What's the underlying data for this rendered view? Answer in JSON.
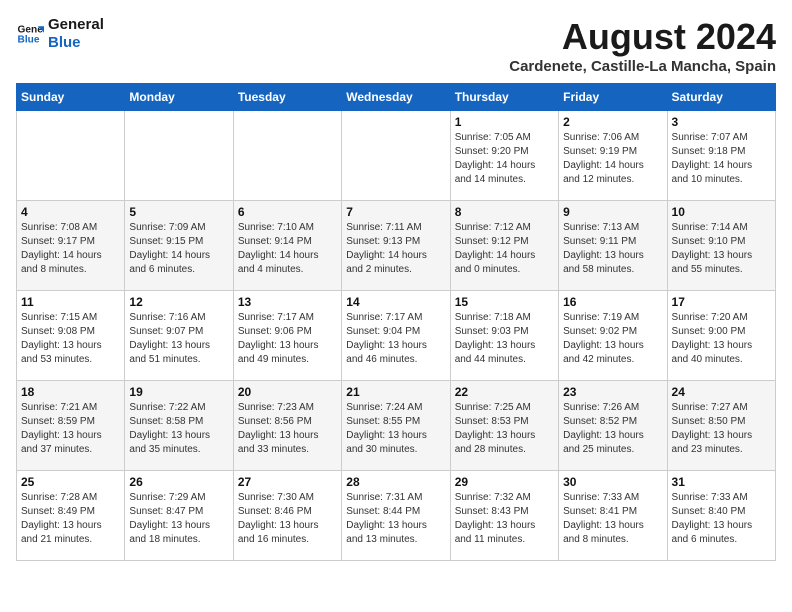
{
  "header": {
    "logo_line1": "General",
    "logo_line2": "Blue",
    "month_title": "August 2024",
    "location": "Cardenete, Castille-La Mancha, Spain"
  },
  "weekdays": [
    "Sunday",
    "Monday",
    "Tuesday",
    "Wednesday",
    "Thursday",
    "Friday",
    "Saturday"
  ],
  "weeks": [
    [
      {
        "day": "",
        "detail": ""
      },
      {
        "day": "",
        "detail": ""
      },
      {
        "day": "",
        "detail": ""
      },
      {
        "day": "",
        "detail": ""
      },
      {
        "day": "1",
        "detail": "Sunrise: 7:05 AM\nSunset: 9:20 PM\nDaylight: 14 hours\nand 14 minutes."
      },
      {
        "day": "2",
        "detail": "Sunrise: 7:06 AM\nSunset: 9:19 PM\nDaylight: 14 hours\nand 12 minutes."
      },
      {
        "day": "3",
        "detail": "Sunrise: 7:07 AM\nSunset: 9:18 PM\nDaylight: 14 hours\nand 10 minutes."
      }
    ],
    [
      {
        "day": "4",
        "detail": "Sunrise: 7:08 AM\nSunset: 9:17 PM\nDaylight: 14 hours\nand 8 minutes."
      },
      {
        "day": "5",
        "detail": "Sunrise: 7:09 AM\nSunset: 9:15 PM\nDaylight: 14 hours\nand 6 minutes."
      },
      {
        "day": "6",
        "detail": "Sunrise: 7:10 AM\nSunset: 9:14 PM\nDaylight: 14 hours\nand 4 minutes."
      },
      {
        "day": "7",
        "detail": "Sunrise: 7:11 AM\nSunset: 9:13 PM\nDaylight: 14 hours\nand 2 minutes."
      },
      {
        "day": "8",
        "detail": "Sunrise: 7:12 AM\nSunset: 9:12 PM\nDaylight: 14 hours\nand 0 minutes."
      },
      {
        "day": "9",
        "detail": "Sunrise: 7:13 AM\nSunset: 9:11 PM\nDaylight: 13 hours\nand 58 minutes."
      },
      {
        "day": "10",
        "detail": "Sunrise: 7:14 AM\nSunset: 9:10 PM\nDaylight: 13 hours\nand 55 minutes."
      }
    ],
    [
      {
        "day": "11",
        "detail": "Sunrise: 7:15 AM\nSunset: 9:08 PM\nDaylight: 13 hours\nand 53 minutes."
      },
      {
        "day": "12",
        "detail": "Sunrise: 7:16 AM\nSunset: 9:07 PM\nDaylight: 13 hours\nand 51 minutes."
      },
      {
        "day": "13",
        "detail": "Sunrise: 7:17 AM\nSunset: 9:06 PM\nDaylight: 13 hours\nand 49 minutes."
      },
      {
        "day": "14",
        "detail": "Sunrise: 7:17 AM\nSunset: 9:04 PM\nDaylight: 13 hours\nand 46 minutes."
      },
      {
        "day": "15",
        "detail": "Sunrise: 7:18 AM\nSunset: 9:03 PM\nDaylight: 13 hours\nand 44 minutes."
      },
      {
        "day": "16",
        "detail": "Sunrise: 7:19 AM\nSunset: 9:02 PM\nDaylight: 13 hours\nand 42 minutes."
      },
      {
        "day": "17",
        "detail": "Sunrise: 7:20 AM\nSunset: 9:00 PM\nDaylight: 13 hours\nand 40 minutes."
      }
    ],
    [
      {
        "day": "18",
        "detail": "Sunrise: 7:21 AM\nSunset: 8:59 PM\nDaylight: 13 hours\nand 37 minutes."
      },
      {
        "day": "19",
        "detail": "Sunrise: 7:22 AM\nSunset: 8:58 PM\nDaylight: 13 hours\nand 35 minutes."
      },
      {
        "day": "20",
        "detail": "Sunrise: 7:23 AM\nSunset: 8:56 PM\nDaylight: 13 hours\nand 33 minutes."
      },
      {
        "day": "21",
        "detail": "Sunrise: 7:24 AM\nSunset: 8:55 PM\nDaylight: 13 hours\nand 30 minutes."
      },
      {
        "day": "22",
        "detail": "Sunrise: 7:25 AM\nSunset: 8:53 PM\nDaylight: 13 hours\nand 28 minutes."
      },
      {
        "day": "23",
        "detail": "Sunrise: 7:26 AM\nSunset: 8:52 PM\nDaylight: 13 hours\nand 25 minutes."
      },
      {
        "day": "24",
        "detail": "Sunrise: 7:27 AM\nSunset: 8:50 PM\nDaylight: 13 hours\nand 23 minutes."
      }
    ],
    [
      {
        "day": "25",
        "detail": "Sunrise: 7:28 AM\nSunset: 8:49 PM\nDaylight: 13 hours\nand 21 minutes."
      },
      {
        "day": "26",
        "detail": "Sunrise: 7:29 AM\nSunset: 8:47 PM\nDaylight: 13 hours\nand 18 minutes."
      },
      {
        "day": "27",
        "detail": "Sunrise: 7:30 AM\nSunset: 8:46 PM\nDaylight: 13 hours\nand 16 minutes."
      },
      {
        "day": "28",
        "detail": "Sunrise: 7:31 AM\nSunset: 8:44 PM\nDaylight: 13 hours\nand 13 minutes."
      },
      {
        "day": "29",
        "detail": "Sunrise: 7:32 AM\nSunset: 8:43 PM\nDaylight: 13 hours\nand 11 minutes."
      },
      {
        "day": "30",
        "detail": "Sunrise: 7:33 AM\nSunset: 8:41 PM\nDaylight: 13 hours\nand 8 minutes."
      },
      {
        "day": "31",
        "detail": "Sunrise: 7:33 AM\nSunset: 8:40 PM\nDaylight: 13 hours\nand 6 minutes."
      }
    ]
  ]
}
